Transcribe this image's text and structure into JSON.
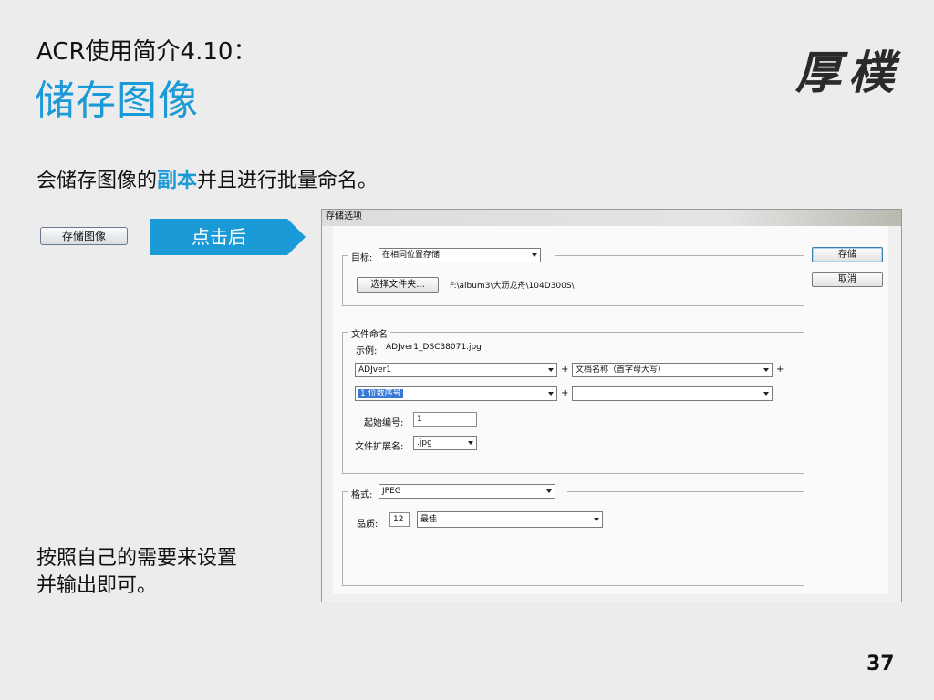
{
  "slide": {
    "title_small": "ACR使用简介4.10：",
    "title_big": "储存图像",
    "logo_text": "厚樸",
    "intro_before": "会储存图像的",
    "intro_highlight": "副本",
    "intro_after": "并且进行批量命名。",
    "save_button_label": "存储图像",
    "arrow_label": "点击后",
    "outro_line1": "按照自己的需要来设置",
    "outro_line2": "并输出即可。",
    "page_number": "37",
    "accent_color": "#1a9ad6"
  },
  "dialog": {
    "title": "存储选项",
    "save_label": "存储",
    "cancel_label": "取消",
    "destination": {
      "label": "目标:",
      "value": "在相同位置存储",
      "choose_folder_label": "选择文件夹...",
      "path": "F:\\album3\\大沥龙舟\\104D300S\\"
    },
    "naming": {
      "legend": "文件命名",
      "example_label": "示例:",
      "example_value": "ADJver1_DSC38071.jpg",
      "field1": "ADJver1",
      "plus1": "+",
      "field2": "文档名称（首字母大写）",
      "plus2": "+",
      "field3": "1 位数序号",
      "plus3": "+",
      "field4": "",
      "start_num_label": "起始编号:",
      "start_num_value": "1",
      "ext_label": "文件扩展名:",
      "ext_value": ".jpg"
    },
    "format": {
      "legend": "格式:",
      "value": "JPEG",
      "quality_label": "品质:",
      "quality_value": "12",
      "quality_level": "最佳"
    }
  }
}
